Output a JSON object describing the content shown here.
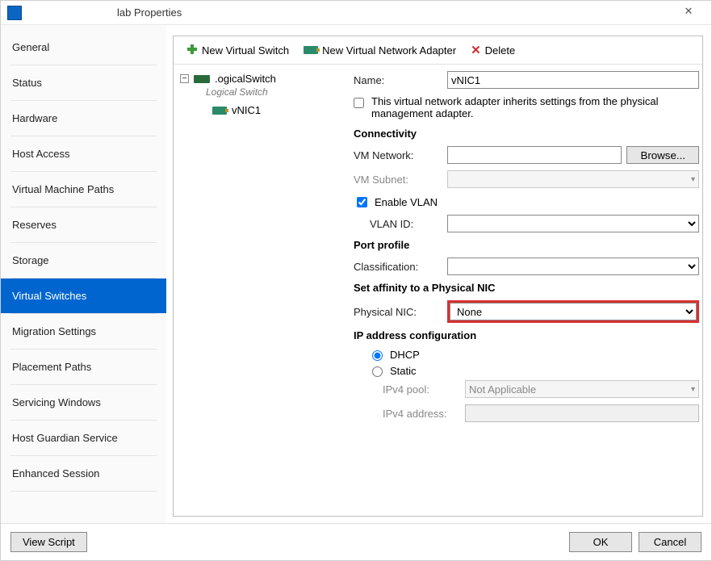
{
  "window": {
    "title": "lab Properties"
  },
  "sidebar": {
    "items": [
      {
        "id": "general",
        "label": "General"
      },
      {
        "id": "status",
        "label": "Status"
      },
      {
        "id": "hardware",
        "label": "Hardware"
      },
      {
        "id": "host-access",
        "label": "Host Access"
      },
      {
        "id": "vm-paths",
        "label": "Virtual Machine Paths"
      },
      {
        "id": "reserves",
        "label": "Reserves"
      },
      {
        "id": "storage",
        "label": "Storage"
      },
      {
        "id": "virtual-switches",
        "label": "Virtual Switches"
      },
      {
        "id": "migration",
        "label": "Migration Settings"
      },
      {
        "id": "placement",
        "label": "Placement Paths"
      },
      {
        "id": "servicing",
        "label": "Servicing Windows"
      },
      {
        "id": "hgs",
        "label": "Host Guardian Service"
      },
      {
        "id": "enhanced",
        "label": "Enhanced Session"
      }
    ],
    "active_index": 7
  },
  "toolbar": {
    "new_switch": "New Virtual Switch",
    "new_adapter": "New Virtual Network Adapter",
    "delete": "Delete"
  },
  "tree": {
    "root_label": ".ogicalSwitch",
    "root_subtitle": "Logical Switch",
    "child_label": "vNIC1"
  },
  "form": {
    "name_label": "Name:",
    "name_value": "vNIC1",
    "inherit_label": "This virtual network adapter inherits settings from the physical management adapter.",
    "connectivity_header": "Connectivity",
    "vm_network_label": "VM Network:",
    "vm_network_value": "",
    "browse_label": "Browse...",
    "vm_subnet_label": "VM Subnet:",
    "enable_vlan_label": "Enable VLAN",
    "vlan_id_label": "VLAN ID:",
    "port_profile_header": "Port profile",
    "classification_label": "Classification:",
    "affinity_header": "Set affinity to a Physical NIC",
    "physical_nic_label": "Physical NIC:",
    "physical_nic_value": "None",
    "ip_header": "IP address configuration",
    "dhcp_label": "DHCP",
    "static_label": "Static",
    "ipv4_pool_label": "IPv4 pool:",
    "ipv4_pool_value": "Not Applicable",
    "ipv4_addr_label": "IPv4 address:"
  },
  "footer": {
    "view_script": "View Script",
    "ok": "OK",
    "cancel": "Cancel"
  }
}
